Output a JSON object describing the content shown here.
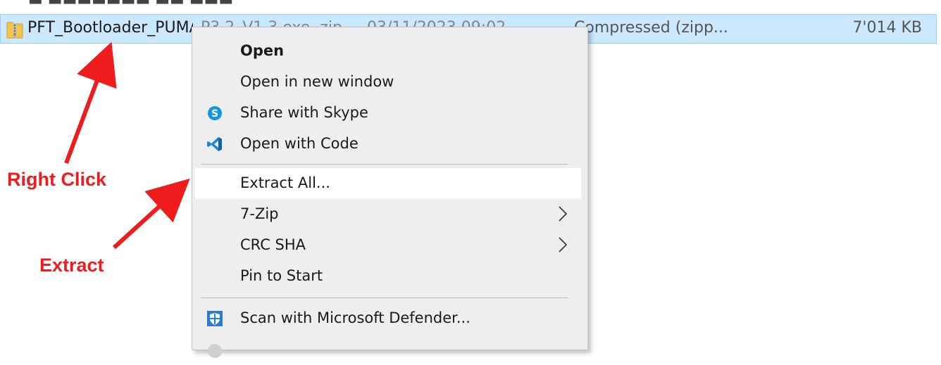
{
  "file_row": {
    "name": "PFT_Bootloader_PUMA",
    "name_obscured": "_P3.2_V1.3.exe .zip",
    "date": "03/11/2023 09:02",
    "type": "Compressed (zipp...",
    "size": "7'014 KB"
  },
  "context_menu": {
    "items": [
      {
        "label": "Open",
        "bold": true
      },
      {
        "label": "Open in new window"
      },
      {
        "label": "Share with Skype",
        "icon": "skype-icon"
      },
      {
        "label": "Open with Code",
        "icon": "vscode-icon"
      },
      {
        "label": "Extract All...",
        "highlighted": true
      },
      {
        "label": "7-Zip",
        "submenu": true
      },
      {
        "label": "CRC SHA",
        "submenu": true
      },
      {
        "label": "Pin to Start"
      },
      {
        "label": "Scan with Microsoft Defender...",
        "icon": "defender-icon"
      }
    ]
  },
  "annotations": {
    "right_click": "Right Click",
    "extract": "Extract"
  },
  "colors": {
    "selection": "#cce8ff",
    "annotation": "#ee1c1c",
    "menu_bg": "#eeeeee"
  }
}
